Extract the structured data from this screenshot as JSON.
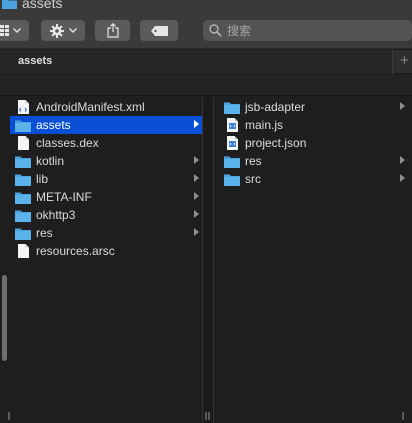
{
  "window": {
    "title": "assets"
  },
  "toolbar": {
    "view_icon": "grid-view-icon",
    "action_icon": "gear-icon",
    "share_icon": "share-icon",
    "tag_icon": "tag-icon",
    "search_placeholder": "搜索"
  },
  "tabs": [
    {
      "label": "assets"
    }
  ],
  "columns": [
    {
      "items": [
        {
          "label": "AndroidManifest.xml",
          "kind": "file-xml",
          "selected": false,
          "has_children": false
        },
        {
          "label": "assets",
          "kind": "folder",
          "selected": true,
          "has_children": true
        },
        {
          "label": "classes.dex",
          "kind": "file",
          "selected": false,
          "has_children": false
        },
        {
          "label": "kotlin",
          "kind": "folder",
          "selected": false,
          "has_children": true
        },
        {
          "label": "lib",
          "kind": "folder",
          "selected": false,
          "has_children": true
        },
        {
          "label": "META-INF",
          "kind": "folder",
          "selected": false,
          "has_children": true
        },
        {
          "label": "okhttp3",
          "kind": "folder",
          "selected": false,
          "has_children": true
        },
        {
          "label": "res",
          "kind": "folder",
          "selected": false,
          "has_children": true
        },
        {
          "label": "resources.arsc",
          "kind": "file",
          "selected": false,
          "has_children": false
        }
      ]
    },
    {
      "items": [
        {
          "label": "jsb-adapter",
          "kind": "folder",
          "selected": false,
          "has_children": true
        },
        {
          "label": "main.js",
          "kind": "file-code",
          "selected": false,
          "has_children": false
        },
        {
          "label": "project.json",
          "kind": "file-code",
          "selected": false,
          "has_children": false
        },
        {
          "label": "res",
          "kind": "folder",
          "selected": false,
          "has_children": true
        },
        {
          "label": "src",
          "kind": "folder",
          "selected": false,
          "has_children": true
        }
      ]
    }
  ],
  "colors": {
    "selection": "#0b4fd6",
    "folder": "#4aa3e0",
    "background": "#1e1e1e"
  }
}
